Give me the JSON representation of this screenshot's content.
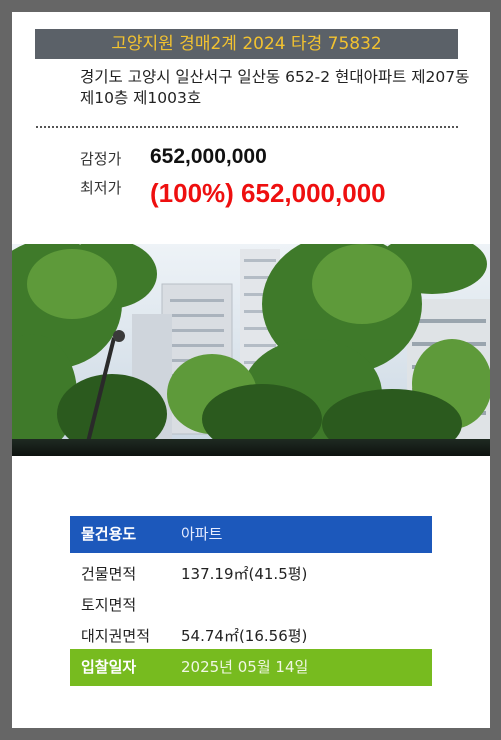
{
  "header": {
    "court_case": "고양지원 경매2계 2024 타경 75832"
  },
  "address": "경기도 고양시 일산서구 일산동 652-2 현대아파트 제207동 제10층 제1003호",
  "prices": {
    "appraisal_label": "감정가",
    "appraisal_value": "652,000,000",
    "minimum_label": "최저가",
    "minimum_value": "(100%) 652,000,000"
  },
  "details": {
    "type_label": "물건용도",
    "type_value": "아파트",
    "building_area_label": "건물면적",
    "building_area_value": "137.19㎡(41.5평)",
    "land_area_label": "토지면적",
    "land_area_value": "",
    "land_right_label": "대지권면적",
    "land_right_value": "54.74㎡(16.56평)",
    "bid_date_label": "입찰일자",
    "bid_date_value": "2025년 05월 14일"
  },
  "colors": {
    "header_bg": "#5b6168",
    "header_text": "#f2c230",
    "minimum_price": "#ee0f0f",
    "type_row_bg": "#1c58bb",
    "date_row_bg": "#77bb1f"
  }
}
